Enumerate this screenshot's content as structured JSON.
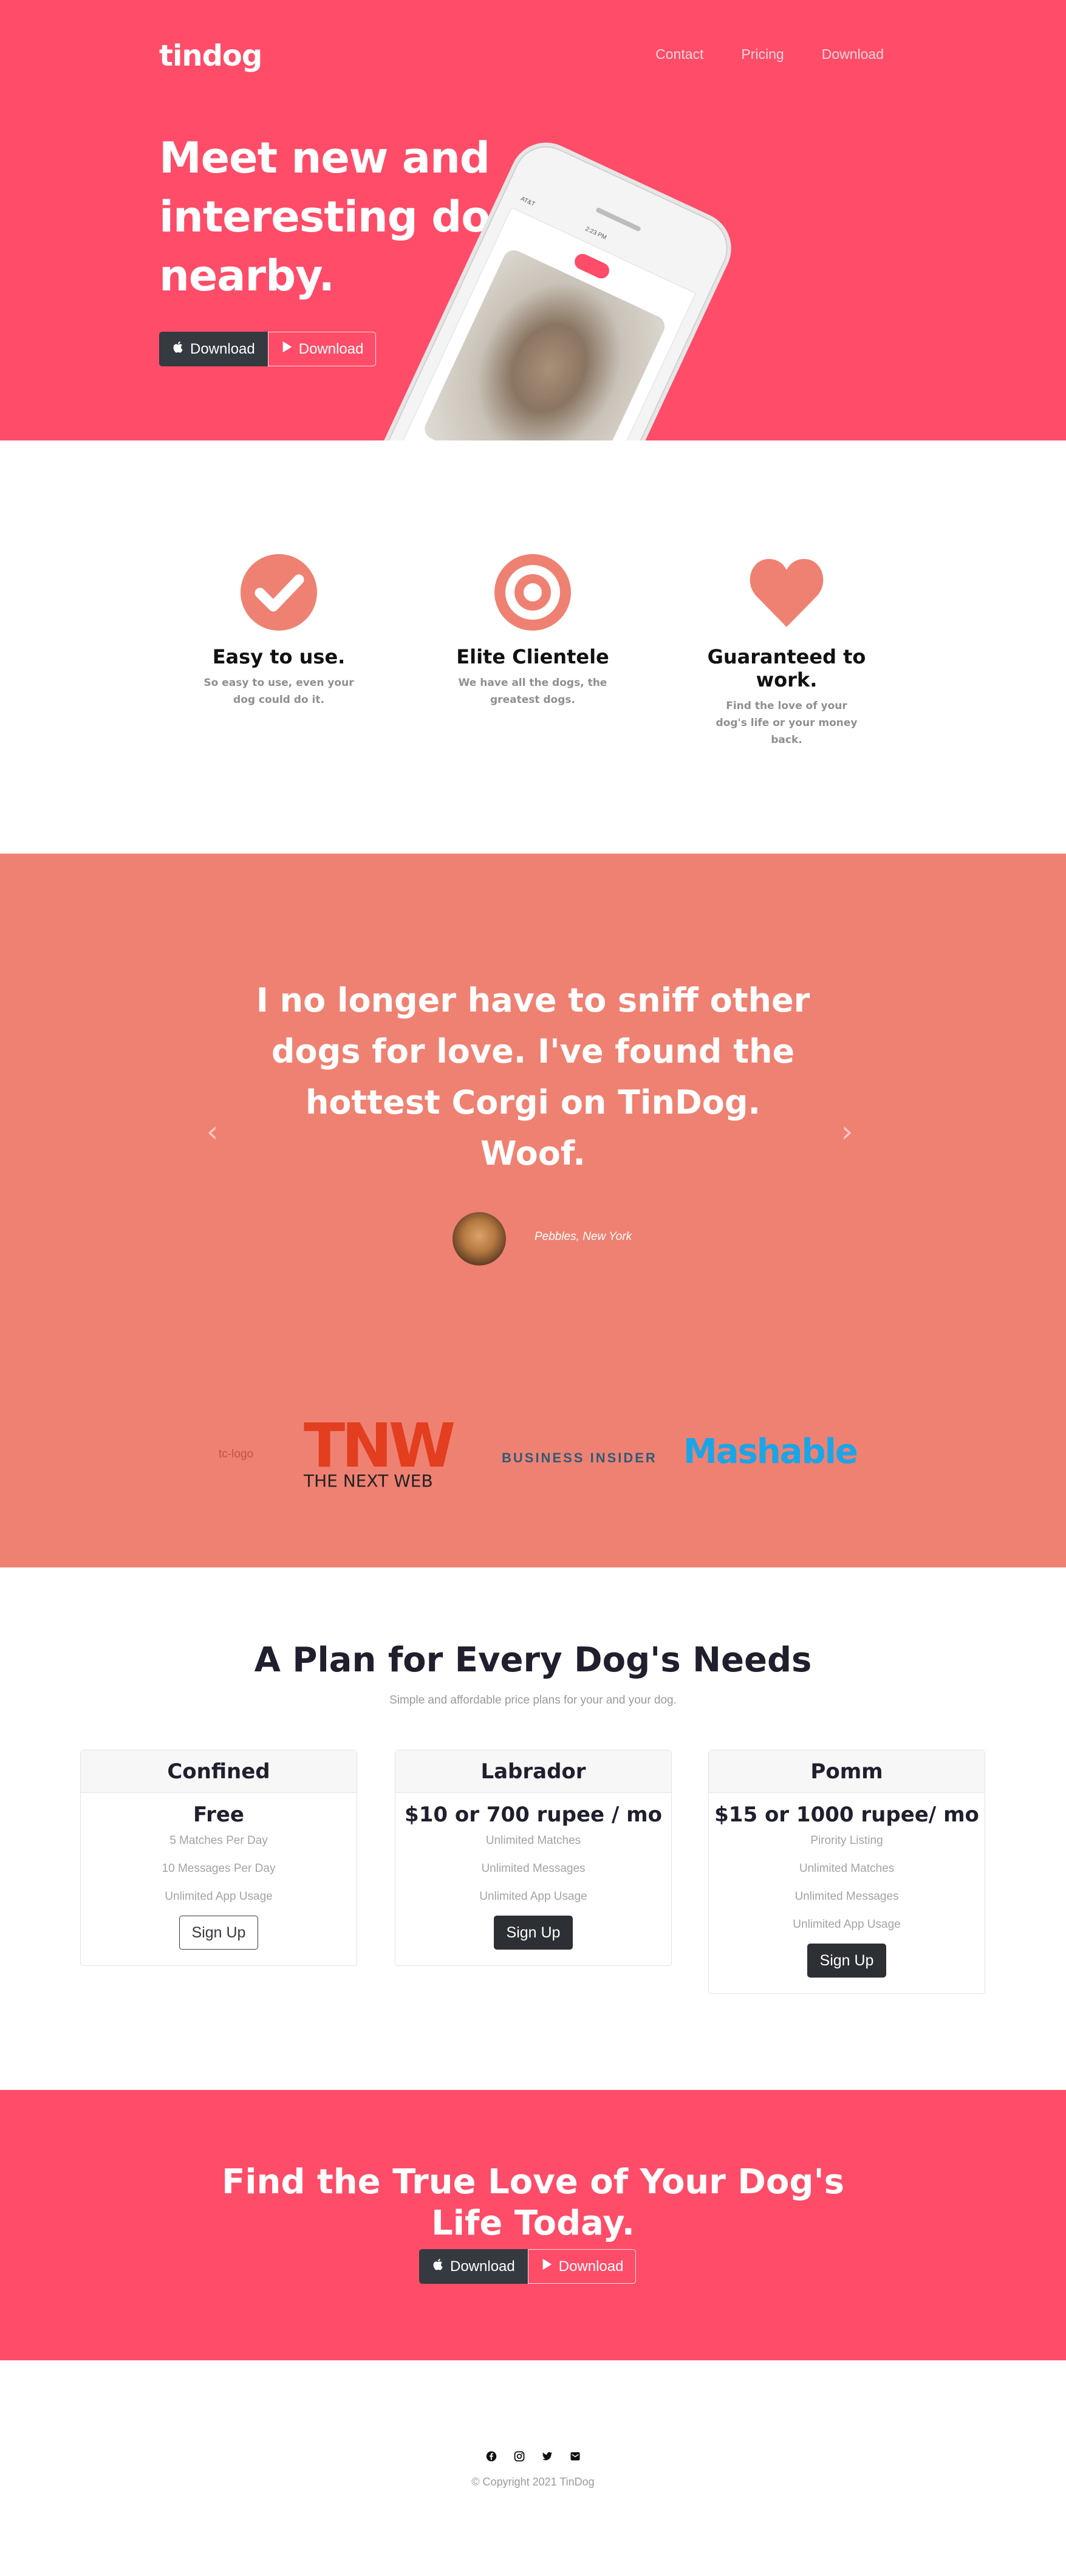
{
  "brand": "tindog",
  "nav": [
    {
      "label": "Contact"
    },
    {
      "label": "Pricing"
    },
    {
      "label": "Download"
    }
  ],
  "hero": {
    "title": "Meet new and interesting dogs nearby.",
    "download_apple": "Download",
    "download_play": "Download",
    "phone_status_time": "2:23 PM",
    "phone_status_carrier": "AT&T"
  },
  "features": [
    {
      "icon": "check-circle-icon",
      "title": "Easy to use.",
      "desc": "So easy to use, even your dog could do it."
    },
    {
      "icon": "bullseye-icon",
      "title": "Elite Clientele",
      "desc": "We have all the dogs, the greatest dogs."
    },
    {
      "icon": "heart-icon",
      "title": "Guaranteed to work.",
      "desc": "Find the love of your dog's life or your money back."
    }
  ],
  "testimonial": {
    "quote": "I no longer have to sniff other dogs for love. I've found the hottest Corgi on TinDog. Woof.",
    "author": "Pebbles, New York",
    "prev": "‹",
    "next": "›"
  },
  "press": {
    "tc_alt": "tc-logo",
    "tnw_mark": "TNW",
    "tnw_sub": "THE NEXT WEB",
    "bi": "BUSINESS INSIDER",
    "mashable": "Mashable"
  },
  "pricing": {
    "title": "A Plan for Every Dog's Needs",
    "subtitle": "Simple and affordable price plans for your and your dog.",
    "plans": [
      {
        "name": "Confined",
        "price": "Free",
        "features": [
          "5 Matches Per Day",
          "10 Messages Per Day",
          "Unlimited App Usage"
        ],
        "cta": "Sign Up"
      },
      {
        "name": "Labrador",
        "price": "$10 or 700 rupee / mo",
        "features": [
          "Unlimited Matches",
          "Unlimited Messages",
          "Unlimited App Usage"
        ],
        "cta": "Sign Up"
      },
      {
        "name": "Pomm",
        "price": "$15 or 1000 rupee/ mo",
        "features": [
          "Pirority Listing",
          "Unlimited Matches",
          "Unlimited Messages",
          "Unlimited App Usage"
        ],
        "cta": "Sign Up"
      }
    ]
  },
  "cta": {
    "title": "Find the True Love of Your Dog's Life Today.",
    "download_apple": "Download",
    "download_play": "Download"
  },
  "footer": {
    "socials": [
      "facebook-icon",
      "instagram-icon",
      "twitter-icon",
      "email-icon"
    ],
    "copyright": "© Copyright 2021 TinDog"
  },
  "colors": {
    "hero_bg": "#ff4c68",
    "testimonial_bg": "#ef8172",
    "feature_icon": "#ef8172",
    "dark_button": "#343a40"
  }
}
